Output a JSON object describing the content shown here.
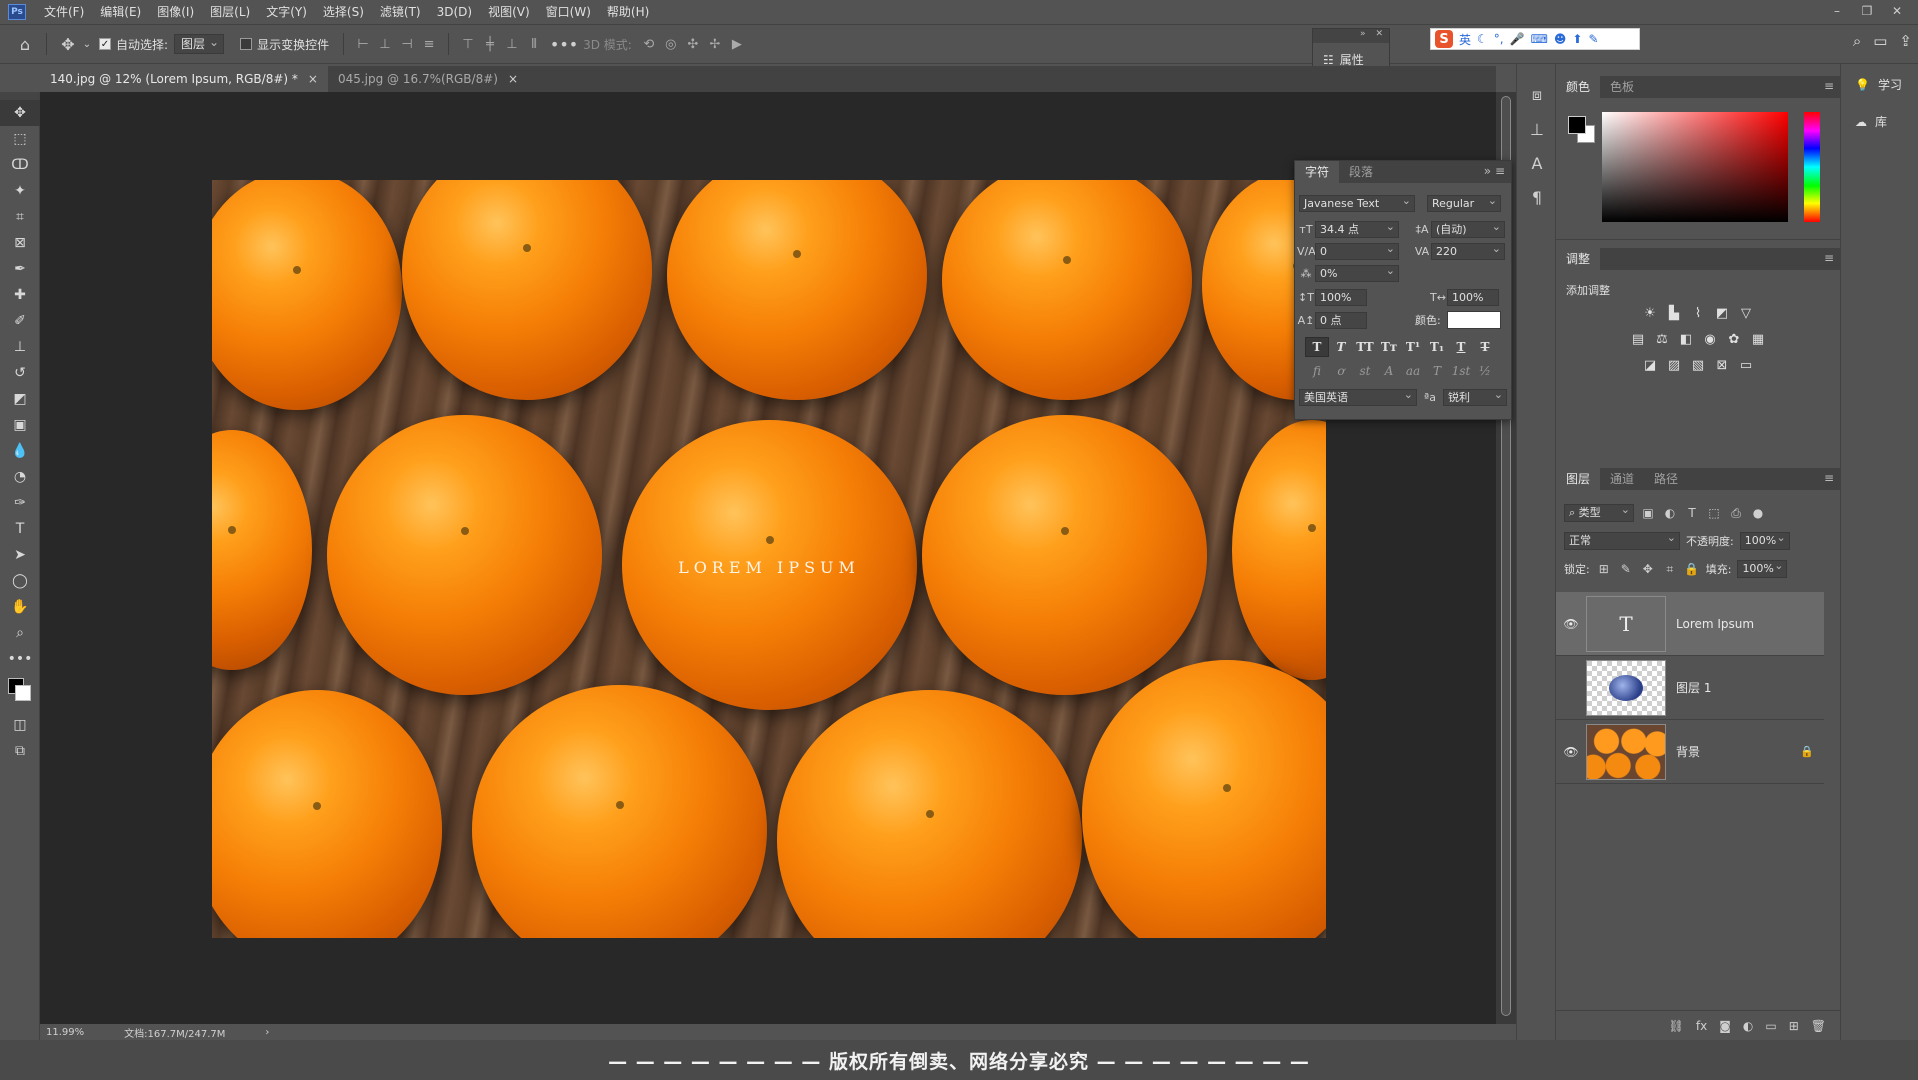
{
  "app": {
    "logo": "Ps"
  },
  "menu": [
    "文件(F)",
    "编辑(E)",
    "图像(I)",
    "图层(L)",
    "文字(Y)",
    "选择(S)",
    "滤镜(T)",
    "3D(D)",
    "视图(V)",
    "窗口(W)",
    "帮助(H)"
  ],
  "options": {
    "auto_select_label": "自动选择:",
    "auto_select_checked": true,
    "auto_select_target": "图层",
    "show_transform_label": "显示变换控件",
    "show_transform_checked": false,
    "more": "•••",
    "mode_3d_label": "3D 模式:"
  },
  "properties_float": {
    "label": "属性"
  },
  "ime": {
    "lang": "英"
  },
  "tabs": [
    {
      "label": "140.jpg @ 12% (Lorem Ipsum, RGB/8#) *",
      "close": "×"
    },
    {
      "label": "045.jpg @ 16.7%(RGB/8#)",
      "close": "×"
    }
  ],
  "canvas": {
    "text": "LOREM IPSUM"
  },
  "character_panel": {
    "tabs": [
      "字符",
      "段落"
    ],
    "font_family": "Javanese Text",
    "font_style": "Regular",
    "font_size": "34.4 点",
    "leading": "(自动)",
    "kerning": "0",
    "tracking": "220",
    "scale_tsume": "0%",
    "vertical_scale": "100%",
    "horizontal_scale": "100%",
    "baseline_shift": "0 点",
    "color_label": "颜色:",
    "language": "美国英语",
    "aa_icon": "ªa",
    "antialias": "锐利",
    "format_buttons": [
      "T",
      "T",
      "TT",
      "Tт",
      "T¹",
      "T₁",
      "T",
      "T"
    ],
    "opentype_buttons": [
      "fi",
      "ơ",
      "st",
      "A",
      "aa",
      "T",
      "1st",
      "½"
    ]
  },
  "color_panel": {
    "tabs": [
      "颜色",
      "色板"
    ],
    "fg": "#000000",
    "bg": "#ffffff"
  },
  "adjustments_panel": {
    "tabs": [
      "调整"
    ],
    "add_label": "添加调整"
  },
  "layers_panel": {
    "tabs": [
      "图层",
      "通道",
      "路径"
    ],
    "filter_kind": "类型",
    "blend_mode": "正常",
    "opacity_label": "不透明度:",
    "opacity": "100%",
    "lock_label": "锁定:",
    "fill_label": "填充:",
    "fill": "100%",
    "layers": [
      {
        "name": "Lorem Ipsum",
        "visible": true,
        "thumb": "T",
        "selected": true
      },
      {
        "name": "图层 1",
        "visible": false,
        "selected": false
      },
      {
        "name": "背景",
        "visible": true,
        "selected": false,
        "locked": true
      }
    ]
  },
  "right_strip": {
    "learn": "学习",
    "libraries": "库"
  },
  "status": {
    "zoom": "11.99%",
    "doc": "文档:167.7M/247.7M",
    "arrow": "›"
  },
  "watermark": "— — — — — — — — 版权所有倒卖、网络分享必究 — — — — — — — —",
  "colors": {
    "bg": "#535353",
    "canvas_bg": "#282828",
    "panel_dark": "#424242"
  }
}
